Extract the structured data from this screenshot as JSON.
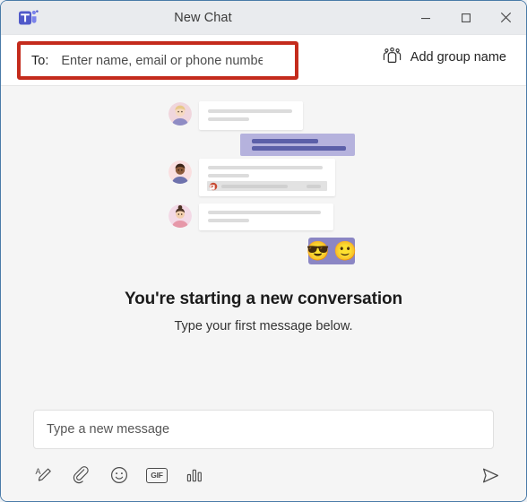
{
  "window": {
    "title": "New Chat",
    "logo_icon": "teams-logo-icon",
    "controls": {
      "minimize": "minimize-icon",
      "maximize": "maximize-icon",
      "close": "close-icon"
    }
  },
  "recipient_bar": {
    "to_label": "To:",
    "to_placeholder": "Enter name, email or phone number",
    "to_value": "",
    "highlight_color": "#c42b1c",
    "add_group": {
      "label": "Add group name",
      "icon": "people-group-icon"
    }
  },
  "main": {
    "headline": "You're starting a new conversation",
    "subline": "Type your first message below.",
    "illustration": {
      "alt": "chat-conversation-illustration",
      "bubble_purple_color": "#b5b2dd",
      "bubble_white_color": "#ffffff",
      "emoji_box_color": "#8b86c4",
      "emojis": [
        "😎",
        "🙂"
      ],
      "attachment_icon": "powerpoint-file-icon"
    }
  },
  "composer": {
    "placeholder": "Type a new message",
    "value": "",
    "toolbar": [
      {
        "name": "format-text-icon",
        "label": "Format"
      },
      {
        "name": "attach-file-icon",
        "label": "Attach"
      },
      {
        "name": "emoji-icon",
        "label": "Emoji"
      },
      {
        "name": "gif-icon",
        "label": "GIF"
      },
      {
        "name": "sticker-poll-icon",
        "label": "Stickers"
      }
    ],
    "send": {
      "name": "send-icon",
      "label": "Send"
    }
  }
}
